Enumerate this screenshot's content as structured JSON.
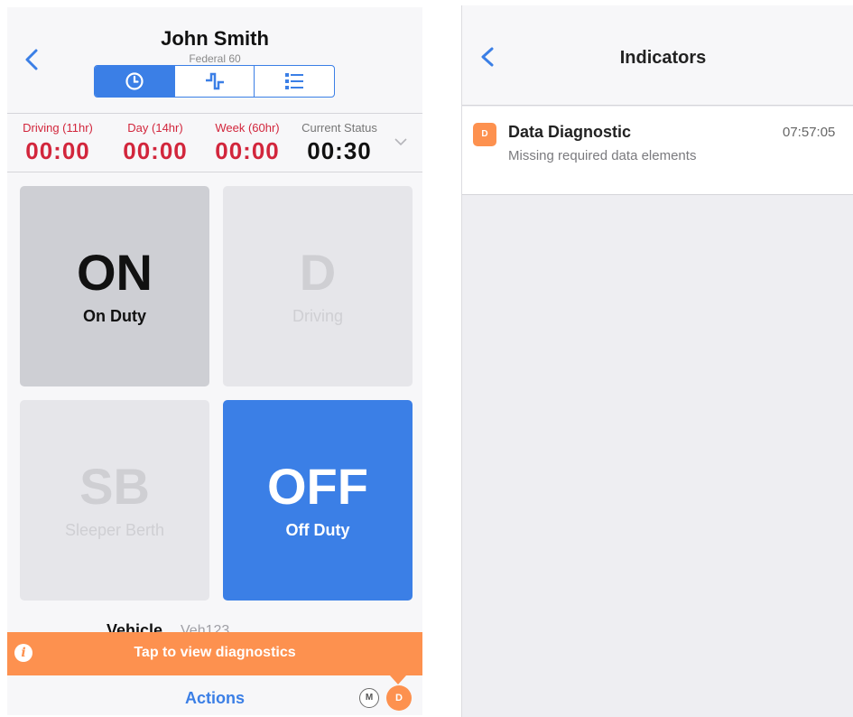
{
  "left": {
    "driver_name": "John Smith",
    "ruleset": "Federal 60",
    "tabs": [
      "clock-icon",
      "graph-icon",
      "list-icon"
    ],
    "hos": [
      {
        "label": "Driving (11hr)",
        "value": "00:00"
      },
      {
        "label": "Day (14hr)",
        "value": "00:00"
      },
      {
        "label": "Week (60hr)",
        "value": "00:00"
      },
      {
        "label": "Current Status",
        "value": "00:30"
      }
    ],
    "tiles": [
      {
        "code": "ON",
        "label": "On Duty",
        "state": "selected"
      },
      {
        "code": "D",
        "label": "Driving",
        "state": "disabled"
      },
      {
        "code": "SB",
        "label": "Sleeper Berth",
        "state": "disabled"
      },
      {
        "code": "OFF",
        "label": "Off Duty",
        "state": "active"
      }
    ],
    "vehicle_label": "Vehicle",
    "vehicle_value": "Veh123",
    "banner_text": "Tap to view diagnostics",
    "actions_label": "Actions",
    "badge_m": "M",
    "badge_d": "D",
    "colors": {
      "accent": "#3b7fe6",
      "warning": "#fd914f",
      "alert": "#d2263c"
    }
  },
  "right": {
    "title": "Indicators",
    "items": [
      {
        "badge": "D",
        "title": "Data Diagnostic",
        "subtitle": "Missing required data elements",
        "time": "07:57:05"
      }
    ]
  }
}
